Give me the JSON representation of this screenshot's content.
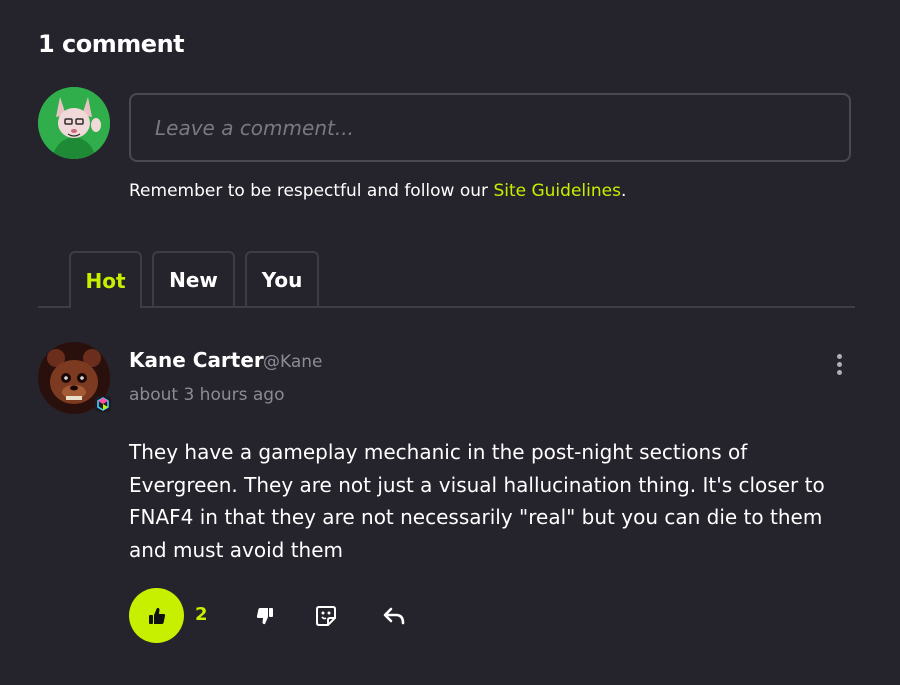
{
  "comments_section": {
    "count_heading": "1 comment"
  },
  "composer": {
    "placeholder": "Leave a comment...",
    "guideline_prefix": "Remember to be respectful and follow our ",
    "guideline_link": "Site Guidelines",
    "guideline_suffix": "."
  },
  "tabs": [
    {
      "label": "Hot",
      "active": true
    },
    {
      "label": "New",
      "active": false
    },
    {
      "label": "You",
      "active": false
    }
  ],
  "comment": {
    "author_name": "Kane Carter",
    "author_handle": "@Kane",
    "timestamp": "about 3 hours ago",
    "body": "They have a gameplay mechanic in the post-night sections of Evergreen. They are not just a visual hallucination thing. It's closer to FNAF4 in that they are not necessarily \"real\" but you can die to them and must avoid them",
    "like_count": "2",
    "liked": true
  },
  "icons": {
    "like": "thumbs-up-icon",
    "dislike": "thumbs-down-icon",
    "sticker": "sticker-icon",
    "reply": "reply-icon",
    "more": "more-vertical-icon"
  },
  "colors": {
    "background": "#25232c",
    "accent": "#c7f000",
    "muted_text": "#8c8a94",
    "border": "#3e3c46"
  }
}
